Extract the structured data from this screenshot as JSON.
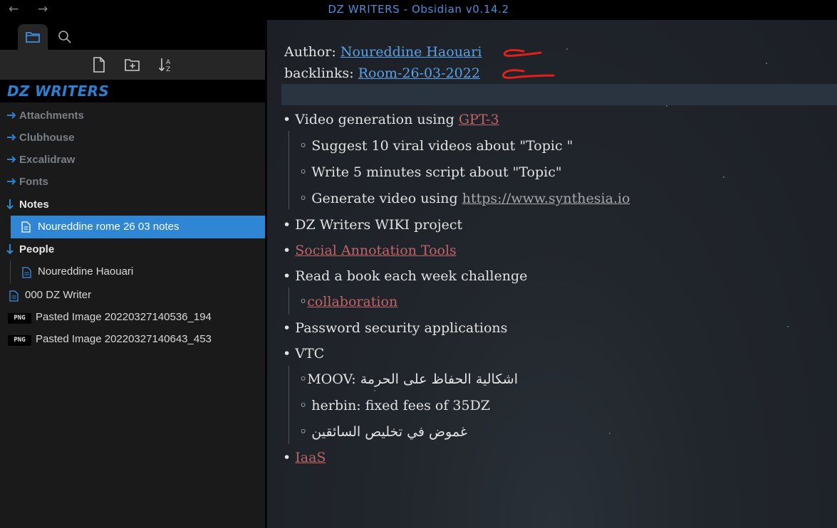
{
  "window": {
    "title": "DZ WRITERS - Obsidian v0.14.2",
    "back_glyph": "←",
    "forward_glyph": "→"
  },
  "sidebar": {
    "vault_name": "DZ WRITERS",
    "tabs": [
      {
        "icon": "folder-icon",
        "active": true
      },
      {
        "icon": "search-icon",
        "active": false
      }
    ],
    "toolbar": [
      {
        "icon": "new-note-icon"
      },
      {
        "icon": "new-folder-icon"
      },
      {
        "icon": "sort-az-icon"
      }
    ],
    "items": [
      {
        "type": "folder",
        "label": "Attachments",
        "expanded": false
      },
      {
        "type": "folder",
        "label": "Clubhouse",
        "expanded": false
      },
      {
        "type": "folder",
        "label": "Excalidraw",
        "expanded": false
      },
      {
        "type": "folder",
        "label": "Fonts",
        "expanded": false
      },
      {
        "type": "folder",
        "label": "Notes",
        "expanded": true
      },
      {
        "type": "file",
        "label": "Noureddine rome 26 03 notes",
        "selected": true
      },
      {
        "type": "folder",
        "label": "People",
        "expanded": true
      },
      {
        "type": "file",
        "label": "Noureddine Haouari"
      },
      {
        "type": "file",
        "label": "000 DZ Writer"
      },
      {
        "type": "image",
        "badge": "PNG",
        "label": "Pasted Image 20220327140536_194"
      },
      {
        "type": "image",
        "badge": "PNG",
        "label": "Pasted Image 20220327140643_453"
      }
    ]
  },
  "editor": {
    "author_label": "Author:",
    "author_link": "Noureddine Haouari",
    "backlinks_label": "backlinks:",
    "backlinks_link": "Room-26-03-2022",
    "bullets": [
      {
        "text": "Video generation using ",
        "link": "GPT-3"
      },
      {
        "text": "Suggest 10 viral videos about \"Topic \""
      },
      {
        "text": "Write 5 minutes script about \"Topic\""
      },
      {
        "text": "Generate video using ",
        "link": "https://www.synthesia.io"
      },
      {
        "text": "DZ Writers WIKI project"
      },
      {
        "link": "Social Annotation Tools"
      },
      {
        "text": "Read a book each week challenge"
      },
      {
        "link": "collaboration"
      },
      {
        "text": "Password security applications"
      },
      {
        "text": "VTC"
      },
      {
        "text": "MOOV: ",
        "arabic": "اشكالية الحفاظ على الحرمة"
      },
      {
        "text": "herbin: fixed fees of  35DZ"
      },
      {
        "arabic": "غموض في تخليص السائقين"
      },
      {
        "link": "IaaS"
      }
    ],
    "bullet_glyph": "•",
    "sub_bullet_glyph": "◦",
    "annotation_color": "#e0201b"
  },
  "colors": {
    "accent": "#2f86d4",
    "link_internal": "#5aa0e6",
    "link_unresolved": "#c06468"
  }
}
